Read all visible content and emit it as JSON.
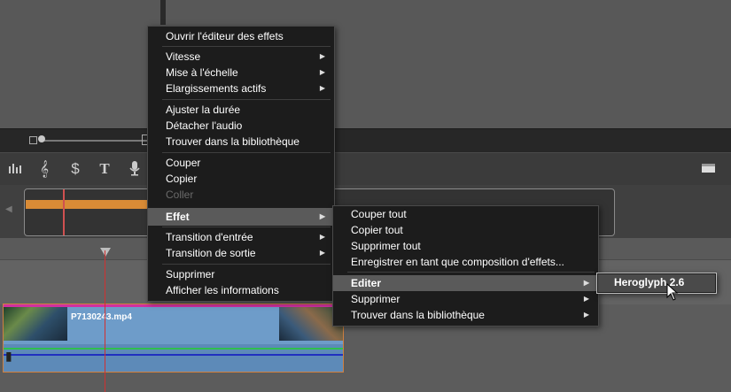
{
  "clip": {
    "name": "P7130243.mp4"
  },
  "toolbar_icons": [
    "levels-icon",
    "treble-clef-icon",
    "s-stroke-icon",
    "title-t-icon",
    "microphone-icon"
  ],
  "context_menu": {
    "open_effects_editor": "Ouvrir l'éditeur des effets",
    "speed": "Vitesse",
    "scaling": "Mise à l'échelle",
    "active_stretching": "Elargissements actifs",
    "adjust_duration": "Ajuster la durée",
    "detach_audio": "Détacher l'audio",
    "find_in_library": "Trouver dans la bibliothèque",
    "cut": "Couper",
    "copy": "Copier",
    "paste": "Coller",
    "effect": "Effet",
    "in_transition": "Transition d'entrée",
    "out_transition": "Transition de sortie",
    "delete": "Supprimer",
    "show_info": "Afficher les informations"
  },
  "effect_submenu": {
    "cut_all": "Couper tout",
    "copy_all": "Copier tout",
    "delete_all": "Supprimer tout",
    "save_as_composition": "Enregistrer en tant que composition d'effets...",
    "edit": "Editer",
    "delete": "Supprimer",
    "find_in_library": "Trouver dans la bibliothèque"
  },
  "edit_submenu": {
    "heroglyph": "Heroglyph 2.6"
  },
  "colors": {
    "highlight": "#5a5a5a",
    "playhead": "#d03030",
    "clip_border": "#d08040",
    "mini_clip": "#d98b36"
  }
}
